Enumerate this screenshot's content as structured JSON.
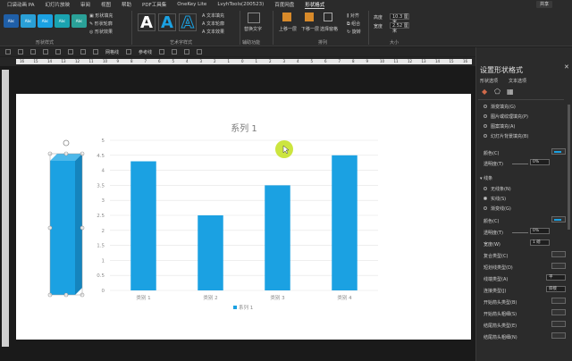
{
  "tabs": [
    "口袋动画 PA",
    "幻灯片放映",
    "审阅",
    "视图",
    "帮助",
    "PDF工具集",
    "OneKey Lite",
    "LvyhTools(200523)",
    "百度网盘",
    "形状格式"
  ],
  "active_tab_index": 9,
  "share_label": "共享",
  "ribbon": {
    "shape_styles": {
      "label": "形状样式",
      "swatches": [
        {
          "text": "Abc",
          "color": "#1f5fa8"
        },
        {
          "text": "Abc",
          "color": "#2a9fd6"
        },
        {
          "text": "Abc",
          "color": "#1ba1e2"
        },
        {
          "text": "Abc",
          "color": "#1aa3b0"
        },
        {
          "text": "Abc",
          "color": "#2aa198"
        }
      ],
      "fill": "形状填充",
      "outline": "形状轮廓",
      "effect": "形状效果"
    },
    "art_styles": {
      "label": "艺术字样式",
      "letter": "A",
      "text_fill": "文本填充",
      "text_outline": "文本轮廓",
      "text_effect": "文本效果"
    },
    "alt_text": {
      "label": "辅助功能",
      "button": "替换文字"
    },
    "arrange": {
      "label": "排列",
      "forward": "上移一层",
      "backward": "下移一层",
      "select_pane": "选择窗格",
      "align": "对齐",
      "group": "组合",
      "rotate": "旋转"
    },
    "size": {
      "label": "大小",
      "height_label": "高度",
      "height_value": "10.3 厘米",
      "width_label": "宽度",
      "width_value": "2.52 厘米"
    }
  },
  "toolbar": {
    "grid": "网格线",
    "guides": "参考线"
  },
  "ruler_numbers": [
    "16",
    "15",
    "14",
    "13",
    "12",
    "11",
    "10",
    "9",
    "8",
    "7",
    "6",
    "5",
    "4",
    "3",
    "2",
    "1",
    "0",
    "1",
    "2",
    "3",
    "4",
    "5",
    "6",
    "7",
    "8",
    "9",
    "10",
    "11",
    "12",
    "13",
    "14",
    "15",
    "16"
  ],
  "chart_data": {
    "type": "bar",
    "title": "系列 1",
    "categories": [
      "类别 1",
      "类别 2",
      "类别 3",
      "类别 4"
    ],
    "series": [
      {
        "name": "系列 1",
        "values": [
          4.3,
          2.5,
          3.5,
          4.5
        ]
      }
    ],
    "ylim": [
      0,
      5
    ],
    "yticks": [
      "0",
      "0.5",
      "1",
      "1.5",
      "2",
      "2.5",
      "3",
      "3.5",
      "4",
      "4.5",
      "5"
    ],
    "grid": true,
    "legend": "bottom",
    "bar_color": "#1ba1e2"
  },
  "pane": {
    "title": "设置形状格式",
    "subtab_shape": "形状选项",
    "subtab_text": "文本选项",
    "fill_options": [
      "渐变填充(G)",
      "图片或纹理填充(P)",
      "图案填充(A)",
      "幻灯片背景填充(B)"
    ],
    "color_label": "颜色(C)",
    "transparency_label": "透明度(T)",
    "transparency_value": "0%",
    "line_section": "线条",
    "line_options": [
      "无线条(N)",
      "实线(S)",
      "渐变线(G)"
    ],
    "line_color_label": "颜色(C)",
    "line_transparency_label": "透明度(T)",
    "line_transparency_value": "0%",
    "width_label": "宽度(W)",
    "width_value": "1 磅",
    "compound_label": "复合类型(C)",
    "dash_label": "短划线类型(D)",
    "cap_label": "线端类型(A)",
    "cap_value": "平",
    "join_label": "连接类型(J)",
    "join_value": "斜接",
    "begin_arrow_type": "开始箭头类型(B)",
    "begin_arrow_size": "开始箭头粗细(S)",
    "end_arrow_type": "结尾箭头类型(E)",
    "end_arrow_size": "结尾箭头粗细(N)"
  }
}
